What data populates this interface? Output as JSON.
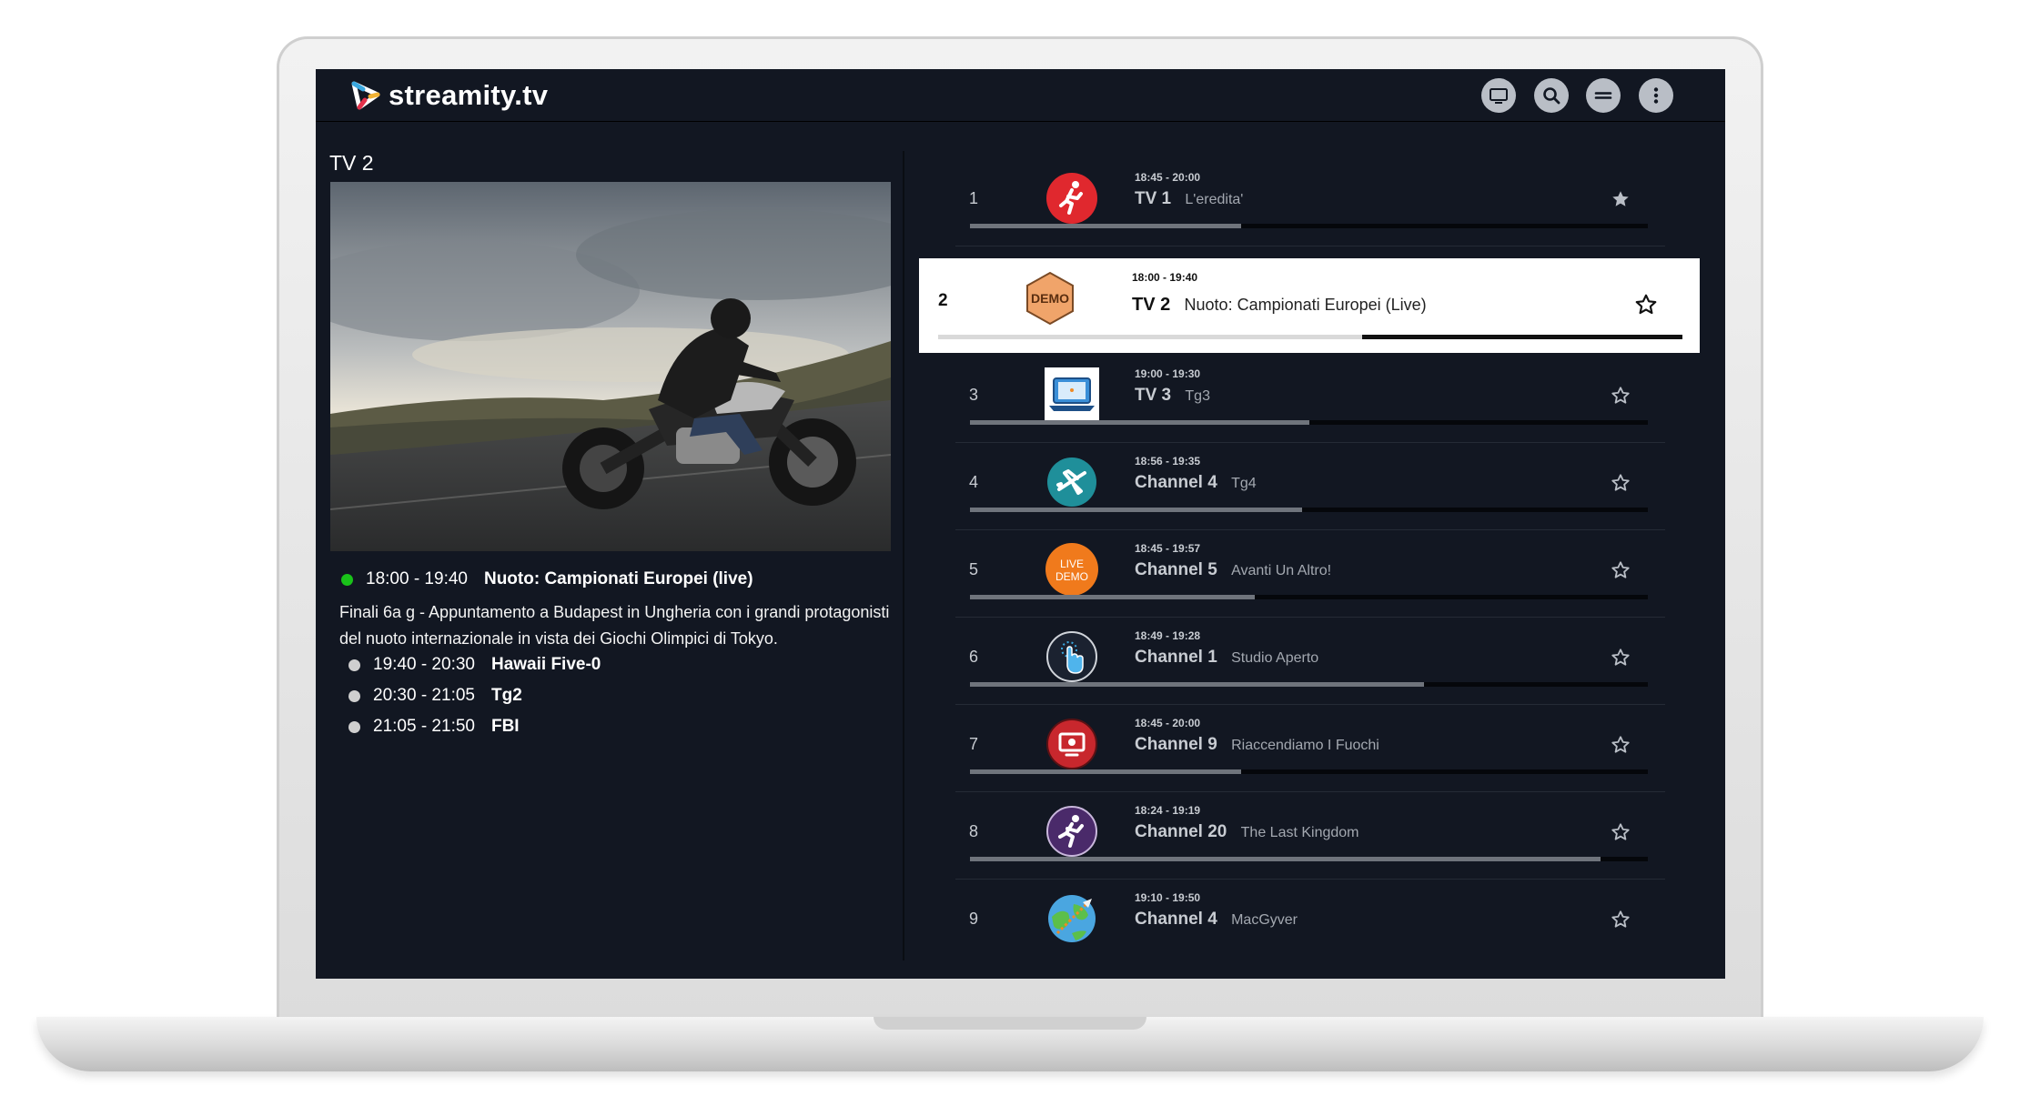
{
  "app": {
    "logo_text": "streamity.tv"
  },
  "header": {
    "buttons": [
      {
        "name": "tv-icon"
      },
      {
        "name": "search-icon"
      },
      {
        "name": "menu-icon"
      },
      {
        "name": "more-vertical-icon"
      }
    ]
  },
  "current_channel": {
    "title": "TV 2",
    "now": {
      "time": "18:00 - 19:40",
      "program": "Nuoto: Campionati Europei (live)"
    },
    "description": "Finali 6a g - Appuntamento a Budapest in Ungheria con i grandi protagonisti del nuoto internazionale in vista dei Giochi Olimpici di Tokyo.",
    "upcoming": [
      {
        "time": "19:40 - 20:30",
        "program": "Hawaii Five-0"
      },
      {
        "time": "20:30 - 21:05",
        "program": "Tg2"
      },
      {
        "time": "21:05 - 21:50",
        "program": "FBI"
      }
    ]
  },
  "channels": [
    {
      "num": "1",
      "time": "18:45 - 20:00",
      "name": "TV 1",
      "program": "L'eredita'",
      "progress": 0.4,
      "logo": "runner-red",
      "favorite": true
    },
    {
      "num": "2",
      "time": "18:00 - 19:40",
      "name": "TV 2",
      "program": "Nuoto: Campionati Europei (Live)",
      "progress": 0.57,
      "logo": "demo-badge",
      "logo_text": "DEMO",
      "favorite": false,
      "selected": true
    },
    {
      "num": "3",
      "time": "19:00 - 19:30",
      "name": "TV 3",
      "program": "Tg3",
      "progress": 0.5,
      "logo": "laptop-blue",
      "favorite": false
    },
    {
      "num": "4",
      "time": "18:56 - 19:35",
      "name": "Channel 4",
      "program": "Tg4",
      "progress": 0.49,
      "logo": "plane-teal",
      "favorite": false
    },
    {
      "num": "5",
      "time": "18:45 - 19:57",
      "name": "Channel 5",
      "program": "Avanti Un Altro!",
      "progress": 0.42,
      "logo": "live-demo-orange",
      "logo_text": "LIVE DEMO",
      "favorite": false
    },
    {
      "num": "6",
      "time": "18:49 - 19:28",
      "name": "Channel 1",
      "program": "Studio Aperto",
      "progress": 0.67,
      "logo": "hand-pointer",
      "favorite": false
    },
    {
      "num": "7",
      "time": "18:45 - 20:00",
      "name": "Channel 9",
      "program": "Riaccendiamo I Fuochi",
      "progress": 0.4,
      "logo": "monitor-red",
      "favorite": false
    },
    {
      "num": "8",
      "time": "18:24 - 19:19",
      "name": "Channel 20",
      "program": "The Last Kingdom",
      "progress": 0.93,
      "logo": "runner-purple",
      "favorite": false
    },
    {
      "num": "9",
      "time": "19:10 - 19:50",
      "name": "Channel 4",
      "program": "MacGyver",
      "progress": 0.0,
      "logo": "globe-plane",
      "favorite": false
    }
  ],
  "colors": {
    "background": "#121722",
    "live_dot": "#19c219",
    "selected_row": "#ffffff"
  }
}
